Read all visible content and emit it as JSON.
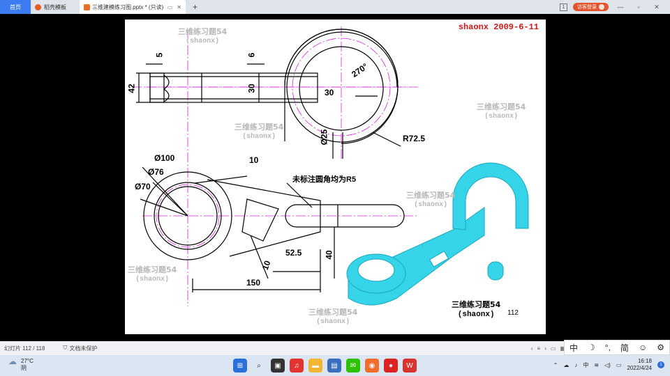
{
  "titlebar": {
    "tabs": [
      {
        "label": "首页"
      },
      {
        "label": "稻壳模板"
      },
      {
        "label": "三维建模练习图.pptx * (只读)"
      }
    ],
    "add_tab": "+",
    "badge": "1",
    "guest_login": "访客登录",
    "controls": [
      "—",
      "▫",
      "✕"
    ]
  },
  "slide": {
    "author_stamp": "shaonx  2009-6-11",
    "watermark_title": "三维练习题54",
    "watermark_sub": "(shaonx)",
    "dimensions": {
      "d5": "5",
      "d6": "6",
      "d42": "42",
      "d30v": "30",
      "d30": "30",
      "a270": "270°",
      "d25": "Ø25",
      "r725": "R72.5",
      "d100": "Ø100",
      "d76": "Ø76",
      "d70": "Ø70",
      "d10top": "10",
      "note": "未标注圆角均为R5",
      "d10bot": "10",
      "d525": "52.5",
      "d40": "40",
      "d150": "150"
    },
    "caption_title": "三维练习题54",
    "caption_sub": "(shaonx)",
    "slide_number": "112",
    "colors": {
      "centerline": "#e020e0",
      "model": "#35d4e8"
    }
  },
  "statusbar": {
    "slide_counter": "幻灯片 112 / 118",
    "protect": "文档未保护"
  },
  "ime": {
    "items": [
      "中",
      "☽",
      "°,",
      "简",
      "☺",
      "⚙"
    ]
  },
  "taskbar": {
    "temperature": "27°C",
    "weather": "阴",
    "time": "16:18",
    "date": "2022/4/24",
    "ime_lang": "中",
    "notification_count": "1"
  }
}
